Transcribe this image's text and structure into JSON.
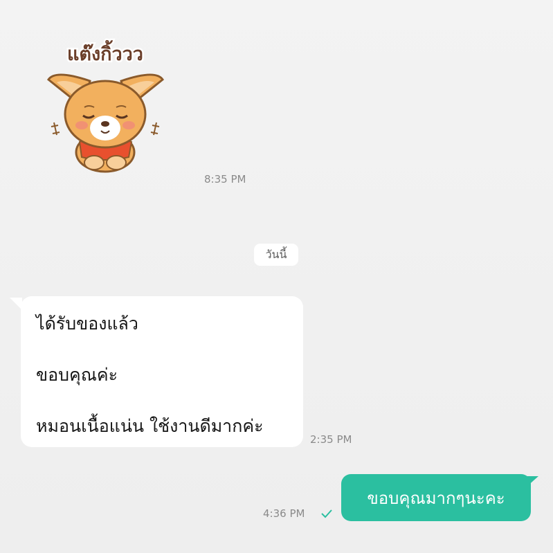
{
  "sticker": {
    "caption": "แต๊งกิ้ววว",
    "icon": "dog-bowing-sticker",
    "time": "8:35 PM"
  },
  "date_separator": "วันนี้",
  "incoming_message": {
    "lines": [
      "ได้รับของแล้ว",
      "ขอบคุณค่ะ",
      "หมอนเนื้อแน่น ใช้งานดีมากค่ะ"
    ],
    "time": "2:35 PM"
  },
  "outgoing_message": {
    "text": "ขอบคุณมากๆนะคะ",
    "time": "4:36 PM",
    "status_icon": "check-icon"
  },
  "colors": {
    "background": "#efefef",
    "outgoing_bubble": "#2bbfa0",
    "incoming_bubble": "#ffffff"
  }
}
